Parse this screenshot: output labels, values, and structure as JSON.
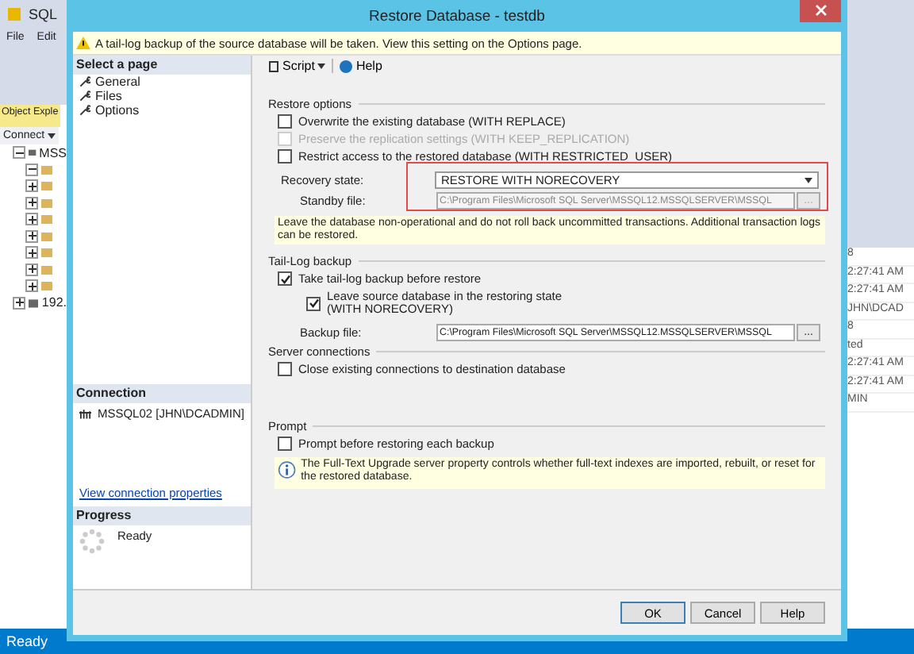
{
  "background_app": {
    "title": "SQL",
    "menu": [
      "File",
      "Edit"
    ],
    "object_explorer": {
      "tab": "Object Exple",
      "connect": "Connect",
      "tree": [
        {
          "label": "MSS",
          "expanded": true,
          "children": [
            {
              "expanded": true
            },
            {
              "expanded": false
            },
            {
              "expanded": false
            },
            {
              "expanded": false
            },
            {
              "expanded": false
            },
            {
              "expanded": false
            },
            {
              "expanded": false
            },
            {
              "expanded": false
            }
          ]
        },
        {
          "label": "192.",
          "expanded": false
        }
      ]
    },
    "properties_fragments": [
      "8",
      "2:27:41 AM",
      "2:27:41 AM",
      "JHN\\DCAD",
      "8",
      "ted",
      "2:27:41 AM",
      "2:27:41 AM",
      "MIN"
    ],
    "status": "Ready"
  },
  "dialog": {
    "title": "Restore Database - testdb",
    "warning": "A tail-log backup of the source database will be taken. View this setting on the Options page.",
    "pages_heading": "Select a page",
    "pages": [
      {
        "label": "General"
      },
      {
        "label": "Files"
      },
      {
        "label": "Options"
      }
    ],
    "toolbar": {
      "script": "Script",
      "help": "Help"
    },
    "restore_options": {
      "heading": "Restore options",
      "options": [
        {
          "label": "Overwrite the existing database (WITH REPLACE)",
          "checked": false,
          "disabled": false
        },
        {
          "label": "Preserve the replication settings (WITH KEEP_REPLICATION)",
          "checked": false,
          "disabled": true
        },
        {
          "label": "Restrict access to the restored database (WITH RESTRICTED_USER)",
          "checked": false,
          "disabled": false
        }
      ],
      "recovery_state": {
        "label": "Recovery state:",
        "value": "RESTORE WITH NORECOVERY",
        "highlighted": true
      },
      "standby_file": {
        "label": "Standby file:",
        "value": "C:\\Program Files\\Microsoft SQL Server\\MSSQL12.MSSQLSERVER\\MSSQL",
        "disabled": true,
        "browse": "..."
      },
      "note": "Leave the database non-operational and do not roll back uncommitted transactions. Additional transaction logs can be restored."
    },
    "tail_log": {
      "heading": "Tail-Log backup",
      "take": {
        "label": "Take tail-log backup before restore",
        "checked": true
      },
      "leave": {
        "lines": [
          "Leave source database in the restoring state",
          "(WITH NORECOVERY)"
        ],
        "checked": true
      },
      "backup_file": {
        "label": "Backup file:",
        "value": "C:\\Program Files\\Microsoft SQL Server\\MSSQL12.MSSQLSERVER\\MSSQL",
        "browse": "..."
      }
    },
    "server_connections": {
      "heading": "Server connections",
      "options": [
        {
          "label": "Close existing connections to destination database",
          "checked": false
        }
      ]
    },
    "prompt": {
      "heading": "Prompt",
      "options": [
        {
          "label": "Prompt before restoring each backup",
          "checked": false
        }
      ],
      "info": "The Full-Text Upgrade server property controls whether full-text indexes are imported, rebuilt, or reset for the restored database."
    },
    "connection": {
      "heading": "Connection",
      "server": "MSSQL02 [JHN\\DCADMIN]",
      "link": "View connection properties"
    },
    "progress": {
      "heading": "Progress",
      "status": "Ready"
    },
    "buttons": [
      "OK",
      "Cancel",
      "Help"
    ]
  }
}
